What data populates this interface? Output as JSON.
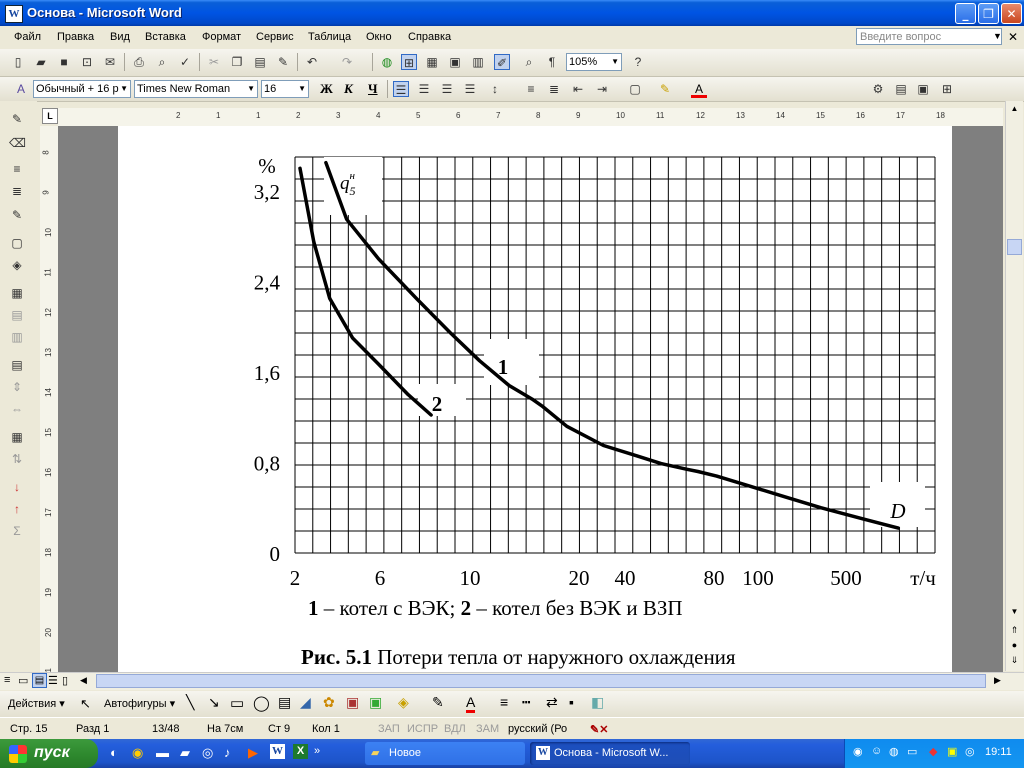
{
  "window": {
    "title": "Основа - Microsoft Word"
  },
  "menu": {
    "items": [
      "Файл",
      "Правка",
      "Вид",
      "Вставка",
      "Формат",
      "Сервис",
      "Таблица",
      "Окно",
      "Справка"
    ],
    "help_placeholder": "Введите вопрос"
  },
  "toolbar": {
    "zoom": "105%"
  },
  "format": {
    "style": "Обычный + 16 р",
    "font": "Times New Roman",
    "size": "16",
    "bold": "Ж",
    "italic": "К",
    "underline": "Ч"
  },
  "ruler": {
    "h_labels": [
      "2",
      "1",
      "1",
      "2",
      "3",
      "4",
      "5",
      "6",
      "7",
      "8",
      "9",
      "10",
      "11",
      "12",
      "13",
      "14",
      "15",
      "16",
      "17",
      "18"
    ],
    "v_labels": [
      "8",
      "9",
      "10",
      "11",
      "12",
      "13",
      "14",
      "15",
      "16",
      "17",
      "18",
      "19",
      "20",
      "21"
    ]
  },
  "document": {
    "legend_text": {
      "n1": "1",
      "t1": " – котел с ВЭК; ",
      "n2": "2",
      "t2": " – котел без ВЭК и ВЗП"
    },
    "caption": {
      "bold": "Рис. 5.1",
      "text": " Потери тепла от наружного охлаждения"
    }
  },
  "chart_data": {
    "type": "line",
    "title": "",
    "ylabel": "%",
    "xlabel": "т/ч",
    "x_scale": "log",
    "y_range": [
      0,
      3.5
    ],
    "grid": true,
    "x_tick_labels": [
      "2",
      "6",
      "10",
      "20",
      "40",
      "80",
      "100",
      "500",
      "т/ч"
    ],
    "y_tick_labels": [
      "0",
      "0,8",
      "1,6",
      "2,4",
      "3,2"
    ],
    "annotations": [
      "q5н",
      "D"
    ],
    "series": [
      {
        "name": "1",
        "x": [
          2.7,
          3.3,
          4.5,
          6.5,
          9,
          12,
          16,
          20,
          22,
          28,
          40,
          55,
          70,
          90,
          100,
          120,
          160,
          230,
          330,
          500,
          700
        ],
        "y": [
          3.45,
          2.95,
          2.6,
          2.25,
          1.95,
          1.7,
          1.48,
          1.36,
          1.3,
          1.12,
          0.95,
          0.86,
          0.79,
          0.74,
          0.72,
          0.68,
          0.6,
          0.5,
          0.4,
          0.3,
          0.22
        ]
      },
      {
        "name": "2",
        "x": [
          2.1,
          2.4,
          2.8,
          3.5,
          4.5,
          6,
          7.5
        ],
        "y": [
          3.4,
          2.75,
          2.25,
          1.9,
          1.67,
          1.4,
          1.22
        ]
      }
    ]
  },
  "statusbar": {
    "page": "Стр. 15",
    "section": "Разд 1",
    "pages": "13/48",
    "at": "На 7см",
    "line": "Ст 9",
    "col": "Кол 1",
    "rec": "ЗАП",
    "trk": "ИСПР",
    "ext": "ВДЛ",
    "ovr": "ЗАМ",
    "lang": "русский (Ро"
  },
  "drawbar": {
    "actions": "Действия ▾",
    "autoshapes": "Автофигуры ▾"
  },
  "taskbar": {
    "start": "пуск",
    "task1": "Новое",
    "task2": "Основа - Microsoft W...",
    "clock": "19:11"
  }
}
